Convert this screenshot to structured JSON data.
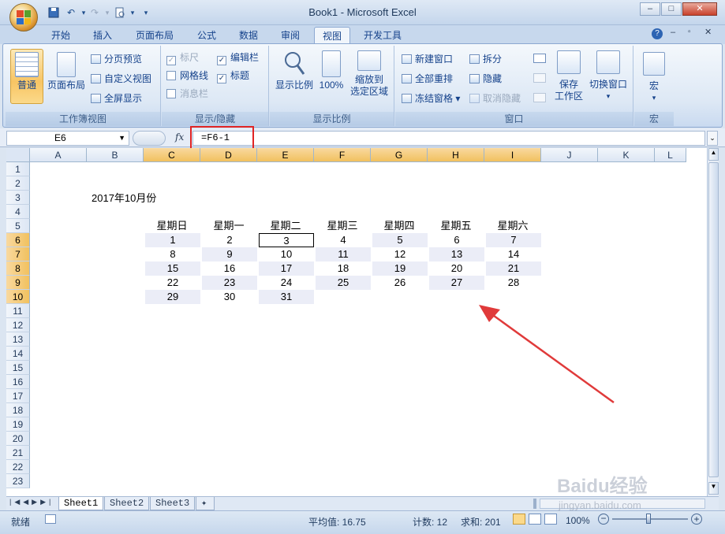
{
  "window": {
    "title": "Book1 - Microsoft Excel",
    "minimize": "–",
    "maximize": "□",
    "close": "✕"
  },
  "qat": [
    "save-icon",
    "undo-icon",
    "redo-icon",
    "print-preview-icon",
    "customize-icon"
  ],
  "tabs": [
    {
      "label": "开始"
    },
    {
      "label": "插入"
    },
    {
      "label": "页面布局"
    },
    {
      "label": "公式"
    },
    {
      "label": "数据"
    },
    {
      "label": "审阅"
    },
    {
      "label": "视图",
      "active": true
    },
    {
      "label": "开发工具"
    }
  ],
  "ribbon": {
    "workbook_views": {
      "label": "工作簿视图",
      "normal": "普通",
      "page_layout": "页面布局",
      "page_break": "分页预览",
      "custom_views": "自定义视图",
      "full_screen": "全屏显示"
    },
    "show_hide": {
      "label": "显示/隐藏",
      "ruler": "标尺",
      "formula_bar": "编辑栏",
      "gridlines": "网格线",
      "headings": "标题",
      "message_bar": "消息栏"
    },
    "zoom": {
      "label": "显示比例",
      "zoom": "显示比例",
      "hundred": "100%",
      "to_selection_line1": "缩放到",
      "to_selection_line2": "选定区域"
    },
    "window": {
      "label": "窗口",
      "new_window": "新建窗口",
      "arrange_all": "全部重排",
      "freeze_panes": "冻结窗格",
      "split": "拆分",
      "hide": "隐藏",
      "unhide": "取消隐藏",
      "save_workspace_line1": "保存",
      "save_workspace_line2": "工作区",
      "switch_windows": "切换窗口"
    },
    "macros": {
      "label": "宏",
      "macros": "宏"
    }
  },
  "formula_bar": {
    "name_box": "E6",
    "fx": "fx",
    "formula": "=F6-1"
  },
  "columns": [
    "A",
    "B",
    "C",
    "D",
    "E",
    "F",
    "G",
    "H",
    "I",
    "J",
    "K",
    "L"
  ],
  "rows": [
    "1",
    "2",
    "3",
    "4",
    "5",
    "6",
    "7",
    "8",
    "9",
    "10",
    "11",
    "12",
    "13",
    "14",
    "15",
    "16",
    "17",
    "18",
    "19",
    "20",
    "21",
    "22",
    "23"
  ],
  "sheet": {
    "title": "2017年10月份",
    "weekdays": [
      "星期日",
      "星期一",
      "星期二",
      "星期三",
      "星期四",
      "星期五",
      "星期六"
    ],
    "weeks": [
      [
        "1",
        "2",
        "3",
        "4",
        "5",
        "6",
        "7"
      ],
      [
        "8",
        "9",
        "10",
        "11",
        "12",
        "13",
        "14"
      ],
      [
        "15",
        "16",
        "17",
        "18",
        "19",
        "20",
        "21"
      ],
      [
        "22",
        "23",
        "24",
        "25",
        "26",
        "27",
        "28"
      ],
      [
        "29",
        "30",
        "31",
        "",
        "",
        "",
        ""
      ]
    ]
  },
  "sheet_tabs": [
    "Sheet1",
    "Sheet2",
    "Sheet3"
  ],
  "status": {
    "ready": "就绪",
    "average": "平均值: 16.75",
    "count": "计数: 12",
    "sum": "求和: 201",
    "zoom": "100%"
  },
  "watermark": {
    "brand": "Baidu经验",
    "url": "jingyan.baidu.com"
  },
  "colors": {
    "highlight_box": "#e02424",
    "arrow": "#e03a3a",
    "shade": "#ebedf7",
    "selected_header": "#f1c15f"
  }
}
